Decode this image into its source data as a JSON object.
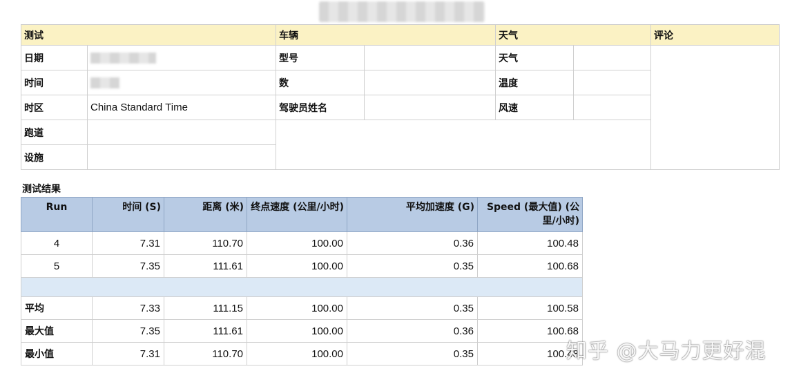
{
  "info": {
    "headers": {
      "test": "测试",
      "vehicle": "车辆",
      "weather": "天气",
      "comments": "评论"
    },
    "rows": {
      "date_label": "日期",
      "time_label": "时间",
      "timezone_label": "时区",
      "timezone_value": "China Standard Time",
      "track_label": "跑道",
      "facility_label": "设施",
      "model_label": "型号",
      "number_label": "数",
      "driver_label": "驾驶员姓名",
      "weather_label": "天气",
      "temperature_label": "温度",
      "wind_label": "风速"
    }
  },
  "results": {
    "title": "测试结果",
    "columns": [
      "Run",
      "时间 (S)",
      "距离 (米)",
      "终点速度 (公里/小时)",
      "平均加速度 (G)",
      "Speed (最大值) (公里/小时)"
    ],
    "runs": [
      [
        "4",
        "7.31",
        "110.70",
        "100.00",
        "0.36",
        "100.48"
      ],
      [
        "5",
        "7.35",
        "111.61",
        "100.00",
        "0.35",
        "100.68"
      ]
    ],
    "summary": [
      [
        "平均",
        "7.33",
        "111.15",
        "100.00",
        "0.35",
        "100.58"
      ],
      [
        "最大值",
        "7.35",
        "111.61",
        "100.00",
        "0.36",
        "100.68"
      ],
      [
        "最小值",
        "7.31",
        "110.70",
        "100.00",
        "0.35",
        "100.48"
      ]
    ]
  },
  "watermark": "知乎 @大马力更好混"
}
